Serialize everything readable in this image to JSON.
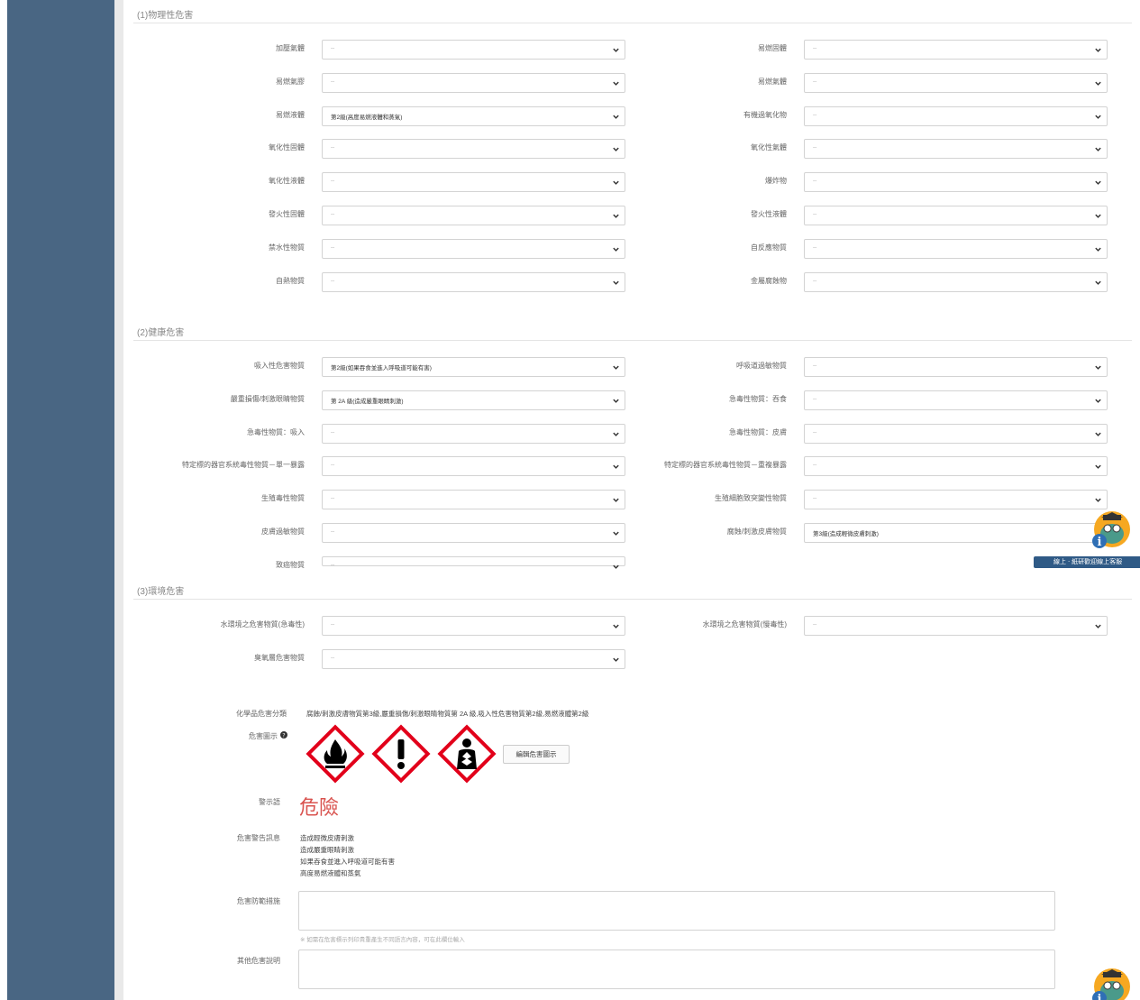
{
  "sections": {
    "physical": {
      "title": "(1)物理性危害",
      "left": [
        {
          "label": "加壓氣體",
          "value": "--"
        },
        {
          "label": "易燃氣膠",
          "value": "--"
        },
        {
          "label": "易燃液體",
          "value": "第2級(高度易燃液體和蒸氣)"
        },
        {
          "label": "氧化性固體",
          "value": "--"
        },
        {
          "label": "氧化性液體",
          "value": "--"
        },
        {
          "label": "發火性固體",
          "value": "--"
        },
        {
          "label": "禁水性物質",
          "value": "--"
        },
        {
          "label": "自熱物質",
          "value": "--"
        }
      ],
      "right": [
        {
          "label": "易燃固體",
          "value": "--"
        },
        {
          "label": "易燃氣體",
          "value": "--"
        },
        {
          "label": "有機過氧化物",
          "value": "--"
        },
        {
          "label": "氧化性氣體",
          "value": "--"
        },
        {
          "label": "爆炸物",
          "value": "--"
        },
        {
          "label": "發火性液體",
          "value": "--"
        },
        {
          "label": "自反應物質",
          "value": "--"
        },
        {
          "label": "金屬腐蝕物",
          "value": "--"
        }
      ]
    },
    "health": {
      "title": "(2)健康危害",
      "left": [
        {
          "label": "吸入性危害物質",
          "value": "第2級(如果吞食並進入呼吸道可能有害)"
        },
        {
          "label": "嚴重損傷/刺激眼睛物質",
          "value": "第 2A 級(造成嚴重眼睛刺激)"
        },
        {
          "label": "急毒性物質：吸入",
          "value": "--"
        },
        {
          "label": "特定標的器官系統毒性物質－單一暴露",
          "value": "--"
        },
        {
          "label": "生殖毒性物質",
          "value": "--"
        },
        {
          "label": "皮膚過敏物質",
          "value": "--"
        },
        {
          "label": "致癌物質",
          "value": "--"
        }
      ],
      "right": [
        {
          "label": "呼吸道過敏物質",
          "value": "--"
        },
        {
          "label": "急毒性物質：吞食",
          "value": "--"
        },
        {
          "label": "急毒性物質：皮膚",
          "value": "--"
        },
        {
          "label": "特定標的器官系統毒性物質－重複暴露",
          "value": "--"
        },
        {
          "label": "生殖細胞致突變性物質",
          "value": "--"
        },
        {
          "label": "腐蝕/刺激皮膚物質",
          "value": "第3級(造成輕微皮膚刺激)"
        }
      ]
    },
    "environment": {
      "title": "(3)環境危害",
      "left": [
        {
          "label": "水環境之危害物質(急毒性)",
          "value": "--"
        },
        {
          "label": "臭氧層危害物質",
          "value": "--"
        }
      ],
      "right": [
        {
          "label": "水環境之危害物質(慢毒性)",
          "value": "--"
        }
      ]
    }
  },
  "summary": {
    "classification_label": "化學品危害分類",
    "classification_text": "腐蝕/刺激皮膚物質第3級,嚴重損傷/刺激眼睛物質第 2A 級,吸入性危害物質第2級,易燃液體第2級",
    "pictogram_label": "危害圖示",
    "pictograms": [
      "flame-icon",
      "exclamation-icon",
      "health-hazard-icon"
    ],
    "edit_pictogram_button": "編輯危害圖示",
    "signal_word_label": "警示語",
    "signal_word": "危險",
    "hazard_statement_label": "危害警告訊息",
    "hazard_statements": [
      "造成輕微皮膚刺激",
      "造成嚴重眼睛刺激",
      "如果吞食並進入呼吸道可能有害",
      "高度易燃液體和蒸氣"
    ],
    "precaution_label": "危害防範措施",
    "precaution_value": "",
    "precaution_hint": "※ 如需在危害標示列印貴重產生不同語言內容，可在此欄位輸入",
    "other_label": "其他危害說明",
    "other_value": ""
  },
  "chat": {
    "label": "線上 ‧ 紙研歡迎線上客服"
  },
  "colors": {
    "sidebar": "#496683",
    "danger": "#d9534f",
    "ghs_red": "#e2001a",
    "chat_bar": "#2f5a86"
  }
}
